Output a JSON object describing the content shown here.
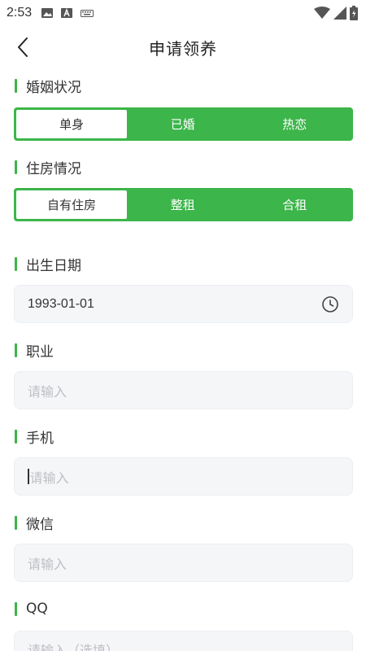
{
  "status_bar": {
    "time": "2:53",
    "left_icons": [
      "image-icon",
      "a-letter-icon",
      "keyboard-icon"
    ],
    "right_icons": [
      "wifi-icon",
      "signal-icon",
      "battery-icon"
    ]
  },
  "header": {
    "title": "申请领养",
    "back_icon": "chevron-left-icon"
  },
  "accent_color": "#3cb54a",
  "marital": {
    "label": "婚姻状况",
    "options": [
      "单身",
      "已婚",
      "热恋"
    ],
    "selected": "单身"
  },
  "housing": {
    "label": "住房情况",
    "options": [
      "自有住房",
      "整租",
      "合租"
    ],
    "selected": "自有住房"
  },
  "birth": {
    "label": "出生日期",
    "value": "1993-01-01",
    "icon": "clock-icon"
  },
  "occupation": {
    "label": "职业",
    "placeholder": "请输入"
  },
  "phone": {
    "label": "手机",
    "placeholder": "请输入"
  },
  "wechat": {
    "label": "微信",
    "placeholder": "请输入"
  },
  "qq": {
    "label": "QQ",
    "placeholder": "请输入（选填）"
  }
}
